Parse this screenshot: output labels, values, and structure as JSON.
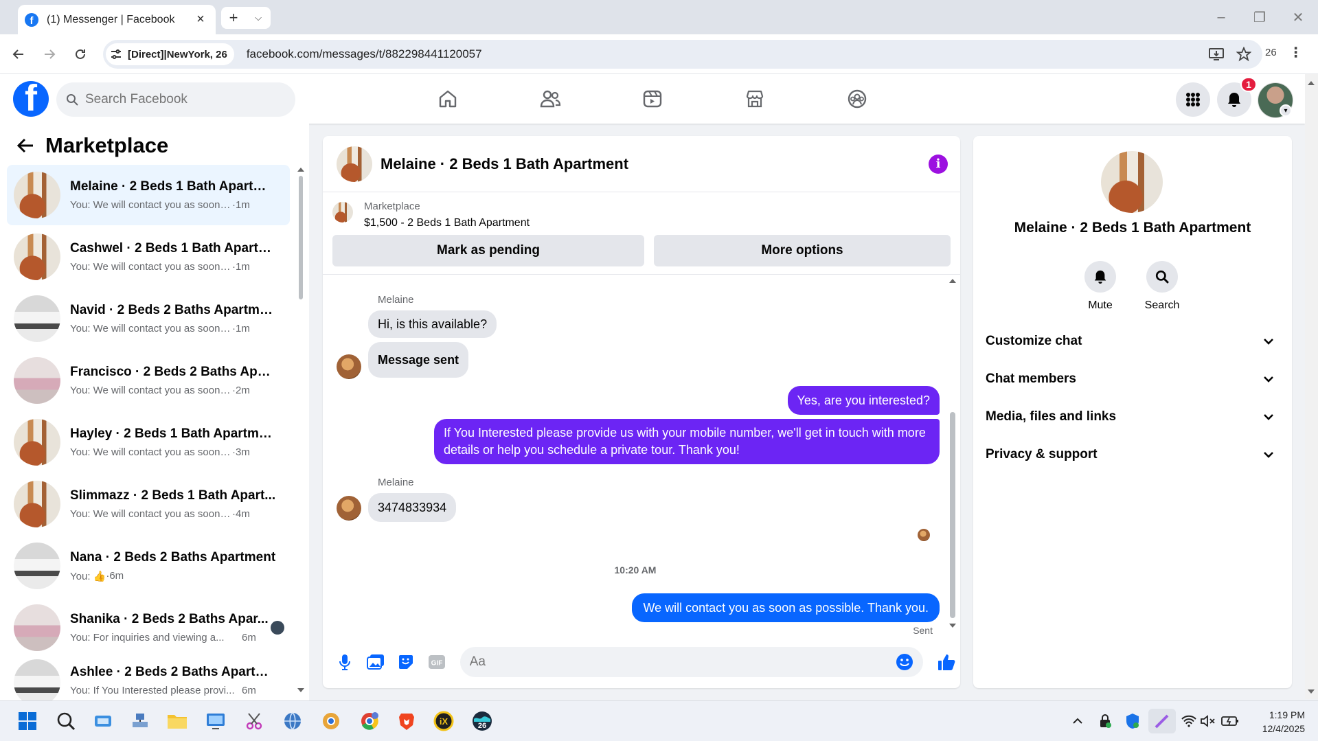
{
  "browser": {
    "tab_title": "(1) Messenger | Facebook",
    "site_chip": "[Direct]|NewYork, 26",
    "url": "facebook.com/messages/t/882298441120057",
    "profile_badge": "26"
  },
  "fb": {
    "search_placeholder": "Search Facebook",
    "notification_count": "1",
    "nav_icons": [
      "home-icon",
      "friends-icon",
      "video-icon",
      "marketplace-icon",
      "groups-icon"
    ]
  },
  "left": {
    "title": "Marketplace",
    "conversations": [
      {
        "name": "Melaine · 2 Beds 1 Bath Apartme...",
        "preview": "You: We will contact you as soon a...",
        "time": "·1m",
        "thumb": "wood",
        "active": true
      },
      {
        "name": "Cashwel · 2 Beds 1 Bath Apartm...",
        "preview": "You: We will contact you as soon a...",
        "time": "·1m",
        "thumb": "wood"
      },
      {
        "name": "Navid · 2 Beds 2 Baths Apartment",
        "preview": "You: We will contact you as soon a...",
        "time": "·1m",
        "thumb": "kitchen"
      },
      {
        "name": "Francisco · 2 Beds 2 Baths Apart...",
        "preview": "You: We will contact you as soon a...",
        "time": "·2m",
        "thumb": "pink"
      },
      {
        "name": "Hayley · 2 Beds 1 Bath Apartment",
        "preview": "You: We will contact you as soon a...",
        "time": "·3m",
        "thumb": "wood"
      },
      {
        "name": "Slimmazz · 2 Beds 1 Bath Apart...",
        "preview": "You: We will contact you as soon a...",
        "time": "·4m",
        "thumb": "wood"
      },
      {
        "name": "Nana · 2 Beds 2 Baths Apartment",
        "preview": "You: 👍",
        "time": "·6m",
        "thumb": "kitchen"
      },
      {
        "name": "Shanika · 2 Beds 2 Baths Apar...",
        "preview": "You: For inquiries and viewing a...",
        "time": "6m",
        "thumb": "pink"
      },
      {
        "name": "Ashlee · 2 Beds 2 Baths Apartme...",
        "preview": "You: If You Interested please provi...",
        "time": "6m",
        "thumb": "kitchen"
      }
    ]
  },
  "chat": {
    "title": "Melaine · 2 Beds 1 Bath Apartment",
    "listing_source": "Marketplace",
    "listing_title": "$1,500 - 2 Beds 1 Bath Apartment",
    "btn_pending": "Mark as pending",
    "btn_more": "More options",
    "sender1": "Melaine",
    "msg1": "Hi, is this available?",
    "msg2": "Message sent",
    "out1": "Yes, are you interested?",
    "out2": "If You Interested please provide us with your mobile number, we'll get in touch with more details or help you schedule a private tour. Thank you!",
    "sender2": "Melaine",
    "msg3": "3474833934",
    "timestamp": "10:20 AM",
    "out3": "We will contact you as soon as possible. Thank you.",
    "sent_status": "Sent",
    "composer_placeholder": "Aa"
  },
  "info": {
    "name": "Melaine · 2 Beds 1 Bath Apartment",
    "mute": "Mute",
    "search": "Search",
    "rows": [
      "Customize chat",
      "Chat members",
      "Media, files and links",
      "Privacy & support"
    ]
  },
  "taskbar": {
    "time": "1:19 PM",
    "date": "12/4/2025",
    "colors": {
      "accent": "#0866ff",
      "purple": "#6c25f4"
    }
  }
}
